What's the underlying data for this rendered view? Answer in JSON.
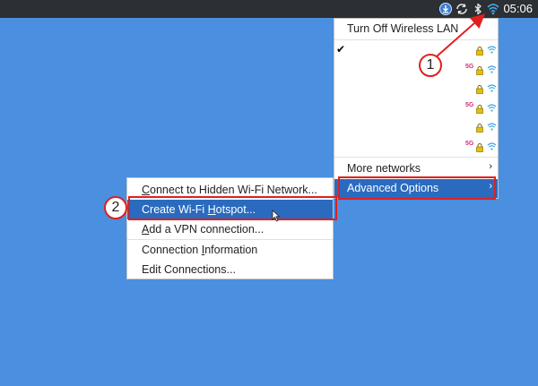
{
  "taskbar": {
    "clock": "05:06",
    "icons": [
      "download-icon",
      "sync-icon",
      "bluetooth-icon",
      "wifi-icon"
    ]
  },
  "network_menu": {
    "turn_off": "Turn Off Wireless LAN",
    "networks": [
      {
        "connected": true,
        "band": "",
        "secured": true
      },
      {
        "connected": false,
        "band": "5G",
        "secured": true
      },
      {
        "connected": false,
        "band": "",
        "secured": true
      },
      {
        "connected": false,
        "band": "5G",
        "secured": true
      },
      {
        "connected": false,
        "band": "",
        "secured": true
      },
      {
        "connected": false,
        "band": "5G",
        "secured": true
      }
    ],
    "more_networks": "More networks",
    "advanced_options": "Advanced Options",
    "check_mark": "✔",
    "submenu_arrow": "›"
  },
  "advanced_menu": {
    "items": [
      {
        "pre": "",
        "mn": "C",
        "post": "onnect to Hidden Wi-Fi Network..."
      },
      {
        "pre": "Create Wi-Fi ",
        "mn": "H",
        "post": "otspot..."
      },
      {
        "pre": "",
        "mn": "A",
        "post": "dd a VPN connection..."
      },
      {
        "pre": "Connection ",
        "mn": "I",
        "post": "nformation"
      },
      {
        "pre": "Edit Connections...",
        "mn": "",
        "post": ""
      }
    ]
  },
  "callouts": {
    "one": "1",
    "two": "2",
    "color": "#e02020"
  },
  "colors": {
    "desktop": "#4a8fe0",
    "taskbar": "#2c2f33",
    "highlight": "#2a6bbf",
    "wifi_tray": "#3fa7e6",
    "band_label": "#d0307a"
  }
}
